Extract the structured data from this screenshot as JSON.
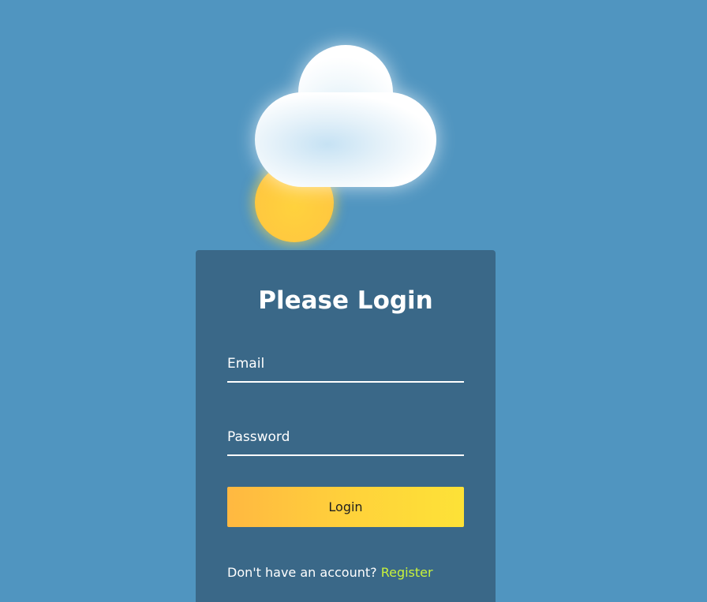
{
  "login": {
    "title": "Please Login",
    "email_placeholder": "Email",
    "email_value": "",
    "password_placeholder": "Password",
    "password_value": "",
    "button_label": "Login",
    "register_prompt": "Don't have an account?",
    "register_link": "Register"
  },
  "colors": {
    "background": "#5095c0",
    "card": "#3a6888",
    "button_start": "#ffb841",
    "button_end": "#fde237",
    "register_link": "#c8f23b",
    "sun": "#ffc93f"
  },
  "icons": [
    "sun-icon",
    "cloud-icon"
  ]
}
